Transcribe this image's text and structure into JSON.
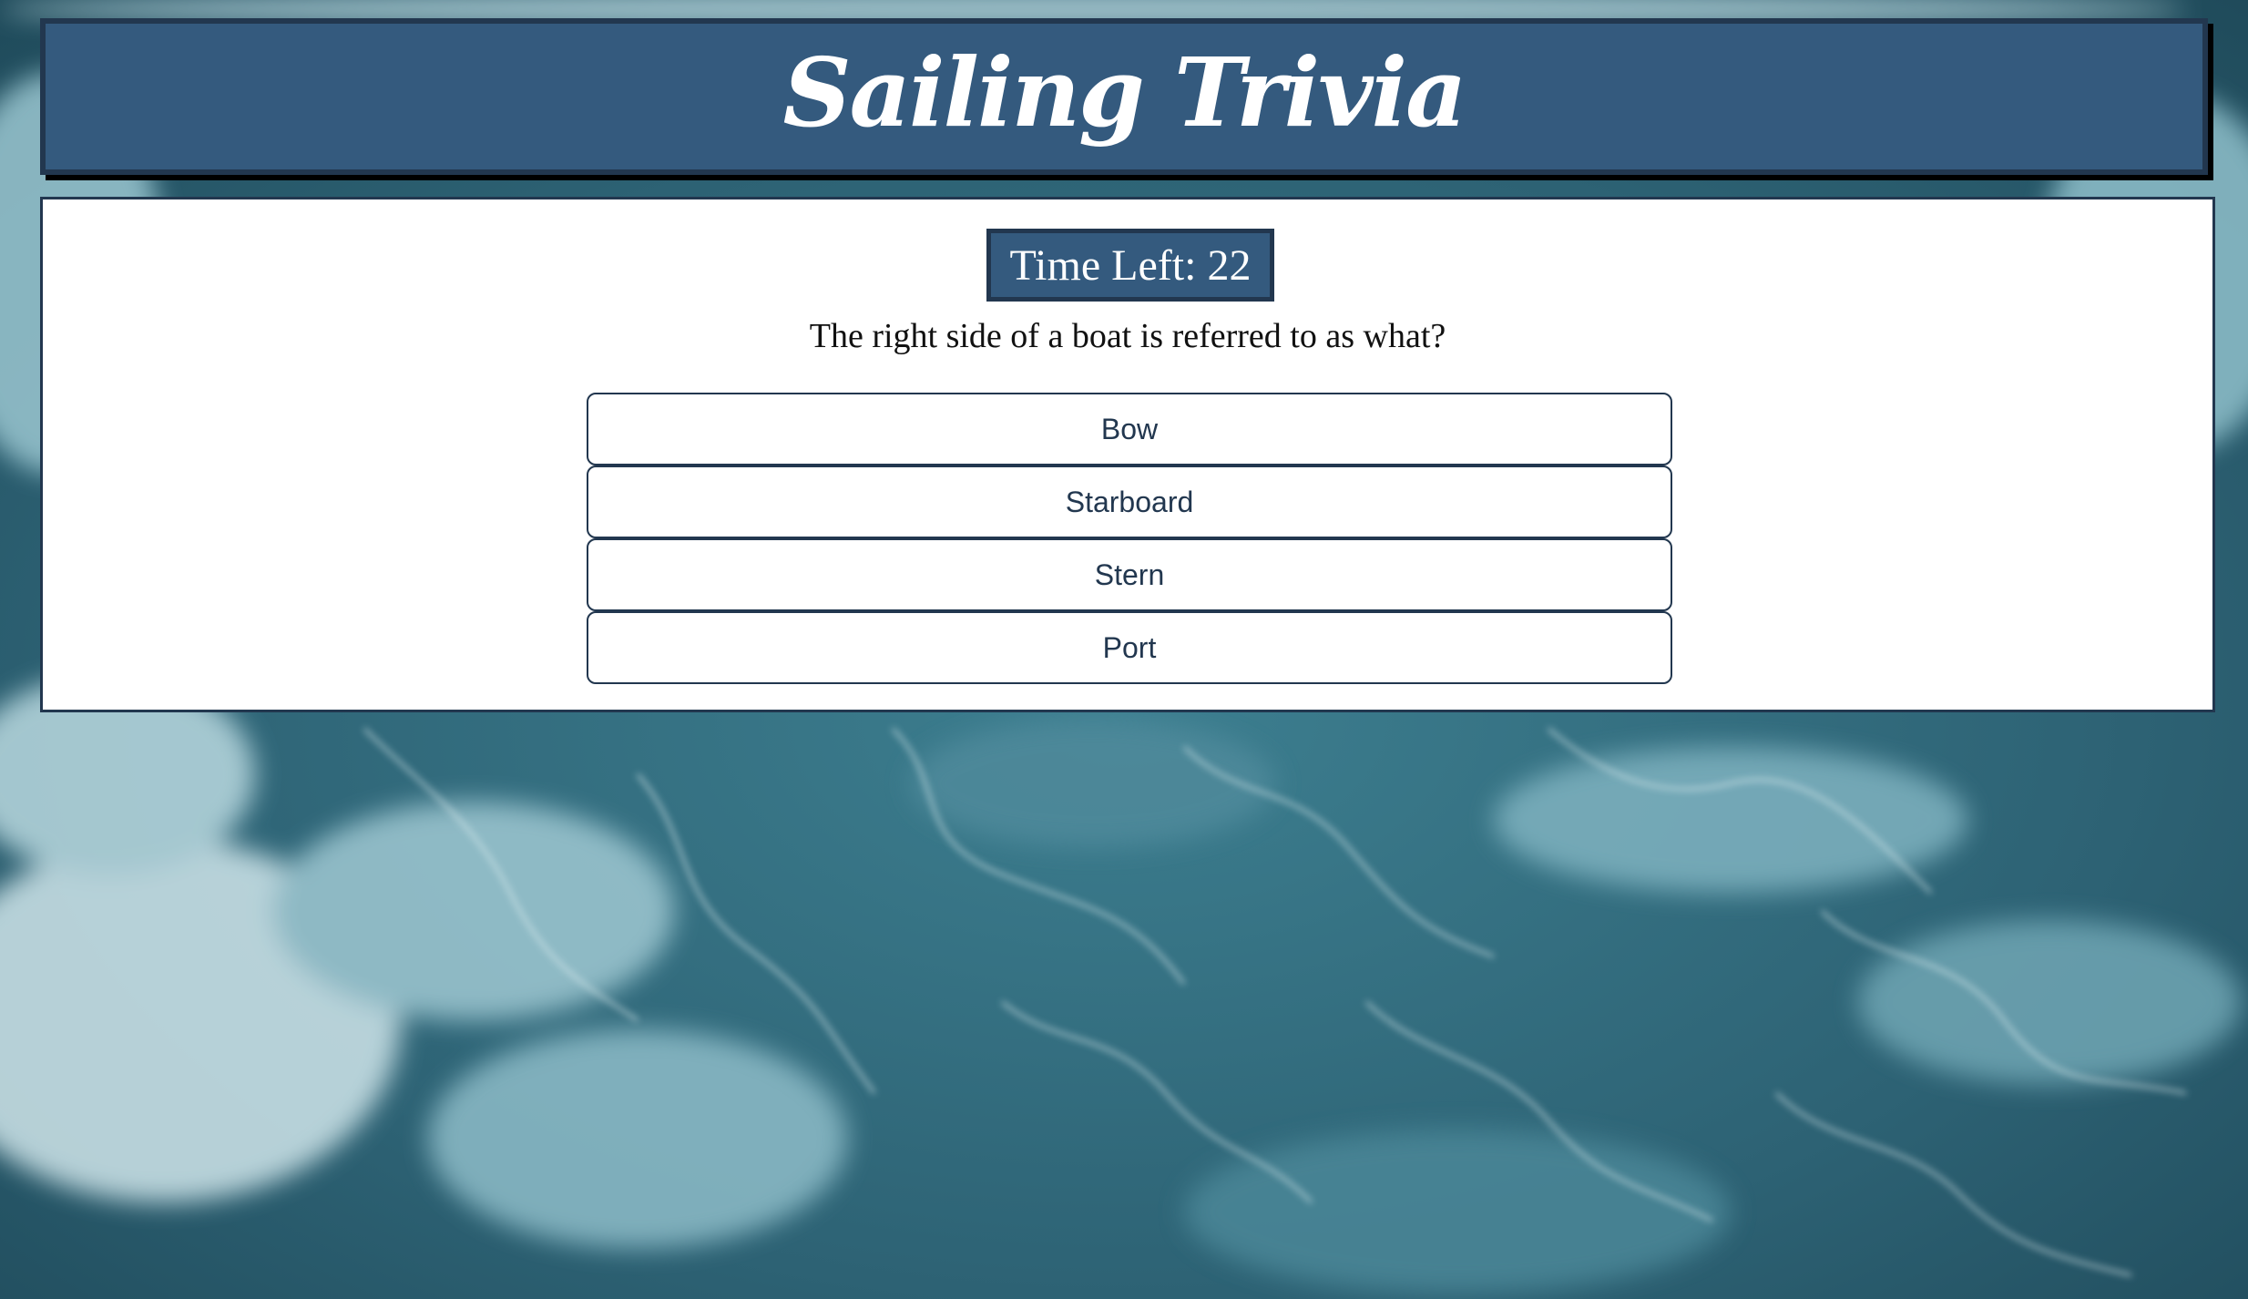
{
  "header": {
    "title": "Sailing Trivia"
  },
  "timer": {
    "label": "Time Left:",
    "seconds": "22"
  },
  "question": {
    "text": "The right side of a boat is referred to as what?"
  },
  "answers": [
    {
      "label": "Bow"
    },
    {
      "label": "Starboard"
    },
    {
      "label": "Stern"
    },
    {
      "label": "Port"
    }
  ],
  "colors": {
    "header_bg": "#345a7e",
    "border": "#22374f",
    "panel_bg": "#ffffff",
    "ocean": "#2f6475"
  }
}
